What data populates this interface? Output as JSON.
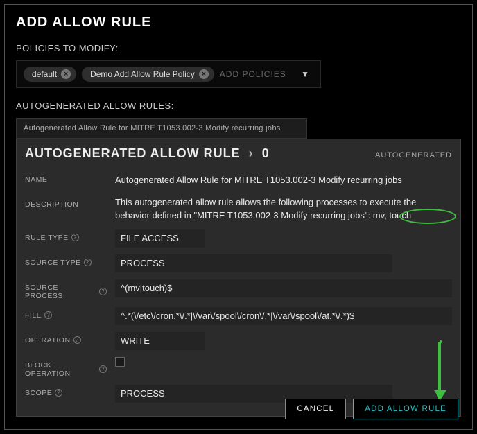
{
  "header": {
    "title": "ADD ALLOW RULE"
  },
  "policies": {
    "label": "POLICIES TO MODIFY:",
    "chips": [
      {
        "label": "default"
      },
      {
        "label": "Demo Add Allow Rule Policy"
      }
    ],
    "placeholder": "ADD POLICIES"
  },
  "rules_section": {
    "label": "AUTOGENERATED ALLOW RULES:",
    "tab_label": "Autogenerated Allow Rule for MITRE T1053.002-3 Modify recurring jobs"
  },
  "panel": {
    "crumb_base": "AUTOGENERATED ALLOW RULE",
    "crumb_index": "0",
    "tag": "AUTOGENERATED",
    "fields": {
      "name_label": "NAME",
      "name_value": "Autogenerated Allow Rule for MITRE T1053.002-3 Modify recurring jobs",
      "desc_label": "DESCRIPTION",
      "desc_value_1": "This autogenerated allow rule allows the following processes to execute the behavior defined in \"MITRE T1053.002-3 Modify recurring jobs\"",
      "desc_value_2": ": mv, touch",
      "ruletype_label": "RULE TYPE",
      "ruletype_value": "FILE ACCESS",
      "sourcetype_label": "SOURCE TYPE",
      "sourcetype_value": "PROCESS",
      "sourceproc_label": "SOURCE PROCESS",
      "sourceproc_value": "^(mv|touch)$",
      "file_label": "FILE",
      "file_value": "^.*(\\/etc\\/cron.*\\/.*|\\/var\\/spool\\/cron\\/.*|\\/var\\/spool\\/at.*\\/.*)$",
      "operation_label": "OPERATION",
      "operation_value": "WRITE",
      "blockop_label": "BLOCK OPERATION",
      "scope_label": "SCOPE",
      "scope_value": "PROCESS"
    }
  },
  "footer": {
    "cancel": "CANCEL",
    "submit": "ADD ALLOW RULE"
  },
  "annotation": {
    "highlight_color": "#3fbf3f"
  }
}
